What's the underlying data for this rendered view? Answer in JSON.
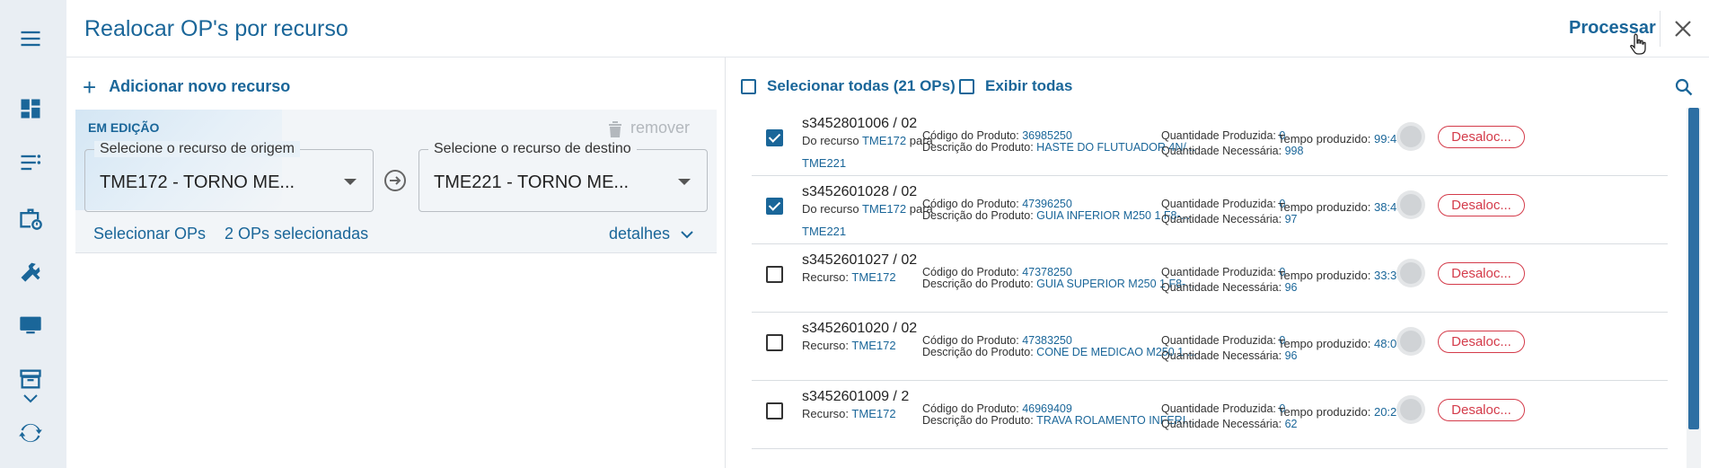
{
  "dialog": {
    "title": "Realocar OP's por recurso",
    "process_label": "Processar"
  },
  "left": {
    "add_resource_label": "Adicionar novo recurso",
    "edit_label": "EM EDIÇÃO",
    "remove_label": "remover",
    "origin": {
      "legend": "Selecione o recurso de origem",
      "value": "TME172 - TORNO ME..."
    },
    "destination": {
      "legend": "Selecione o recurso de destino",
      "value": "TME221 - TORNO ME..."
    },
    "select_ops_label": "Selecionar OPs",
    "selected_count_label": "2 OPs selecionadas",
    "details_label": "detalhes"
  },
  "right": {
    "select_all_label": "Selecionar todas (21 OPs)",
    "show_all_label": "Exibir todas",
    "labels": {
      "from_resource": "Do recurso",
      "to": "para",
      "resource": "Recurso:",
      "product_code": "Código do Produto:",
      "product_desc": "Descrição do Produto:",
      "qty_produced": "Quantidade Produzida:",
      "qty_needed": "Quantidade Necessária:",
      "time_produced": "Tempo produzido:",
      "deallocate": "Desaloc..."
    },
    "rows": [
      {
        "code": "s3452801006 / 02",
        "checked": true,
        "from": "TME172",
        "to": "TME221",
        "product_code": "36985250",
        "product_desc": "HASTE DO FLUTUADOR 4N/...",
        "qty_produced": "0",
        "qty_needed": "998",
        "time": "99:48"
      },
      {
        "code": "s3452601028 / 02",
        "checked": true,
        "from": "TME172",
        "to": "TME221",
        "product_code": "47396250",
        "product_desc": "GUIA INFERIOR M250 1 F8-...",
        "qty_produced": "0",
        "qty_needed": "97",
        "time": "38:48"
      },
      {
        "code": "s3452601027 / 02",
        "checked": false,
        "resource": "TME172",
        "product_code": "47378250",
        "product_desc": "GUIA SUPERIOR M250 1 F8-...",
        "qty_produced": "0",
        "qty_needed": "96",
        "time": "33:36"
      },
      {
        "code": "s3452601020 / 02",
        "checked": false,
        "resource": "TME172",
        "product_code": "47383250",
        "product_desc": "CONE DE MEDICAO M250 1 ...",
        "qty_produced": "0",
        "qty_needed": "96",
        "time": "48:00"
      },
      {
        "code": "s3452601009 / 2",
        "checked": false,
        "resource": "TME172",
        "product_code": "46969409",
        "product_desc": "TRAVA ROLAMENTO INFERI...",
        "qty_produced": "0",
        "qty_needed": "62",
        "time": "20:27"
      }
    ]
  },
  "colors": {
    "accent": "#1a6699",
    "danger": "#d43b4a",
    "rail": "#e9eef3"
  },
  "icons": [
    "menu-icon",
    "dashboard-icon",
    "list-icon",
    "briefcase-clock-icon",
    "tools-icon",
    "monitor-icon",
    "archive-icon",
    "chevron-down-icon",
    "sync-icon",
    "close-icon",
    "search-icon",
    "trash-icon",
    "arrow-right-circle-icon",
    "cursor-hand-icon"
  ]
}
